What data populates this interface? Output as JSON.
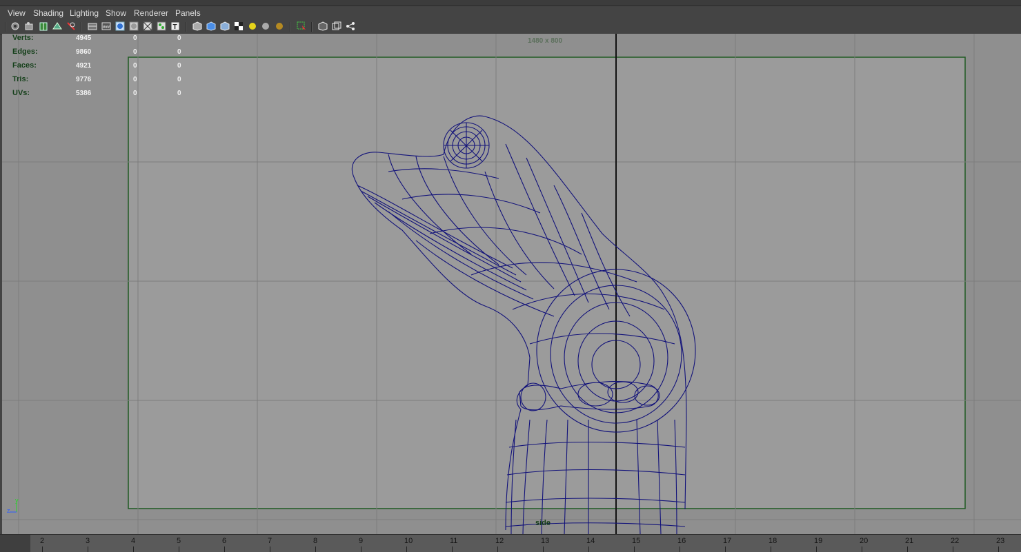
{
  "menu": [
    "View",
    "Shading",
    "Lighting",
    "Show",
    "Renderer",
    "Panels"
  ],
  "toolbar_icons": [
    "camera-select-icon",
    "camera-attributes-icon",
    "bookmark-icon",
    "image-plane-icon",
    "grid-toggle-icon",
    "wireframe-icon",
    "smooth-shade-icon",
    "flat-shade-icon",
    "bounding-box-icon",
    "uv-icon",
    "texture-icon",
    "xray-icon",
    "shaded-cube-icon",
    "lit-cube-icon",
    "checker-icon",
    "default-light-icon",
    "all-lights-icon",
    "shadow-icon",
    "isolate-select-icon",
    "frame-all-icon",
    "frame-selected-icon",
    "camera-path-icon"
  ],
  "hud": {
    "rows": [
      {
        "label": "Verts:",
        "a": "4945",
        "b": "0",
        "c": "0"
      },
      {
        "label": "Edges:",
        "a": "9860",
        "b": "0",
        "c": "0"
      },
      {
        "label": "Faces:",
        "a": "4921",
        "b": "0",
        "c": "0"
      },
      {
        "label": "Tris:",
        "a": "9776",
        "b": "0",
        "c": "0"
      },
      {
        "label": "UVs:",
        "a": "5386",
        "b": "0",
        "c": "0"
      }
    ],
    "resolution": "1480 x 800",
    "camera": "side",
    "axis_y": "y",
    "axis_z": "z"
  },
  "timeline": {
    "ticks": [
      "2",
      "3",
      "4",
      "5",
      "6",
      "7",
      "8",
      "9",
      "10",
      "11",
      "12",
      "13",
      "14",
      "15",
      "16",
      "17",
      "18",
      "19",
      "20",
      "21",
      "22",
      "23"
    ]
  },
  "colors": {
    "viewport_bg": "#8f8f8f",
    "gate_bg": "#9b9b9b",
    "wireframe": "#12127a",
    "gate_border": "#1f5a22"
  }
}
